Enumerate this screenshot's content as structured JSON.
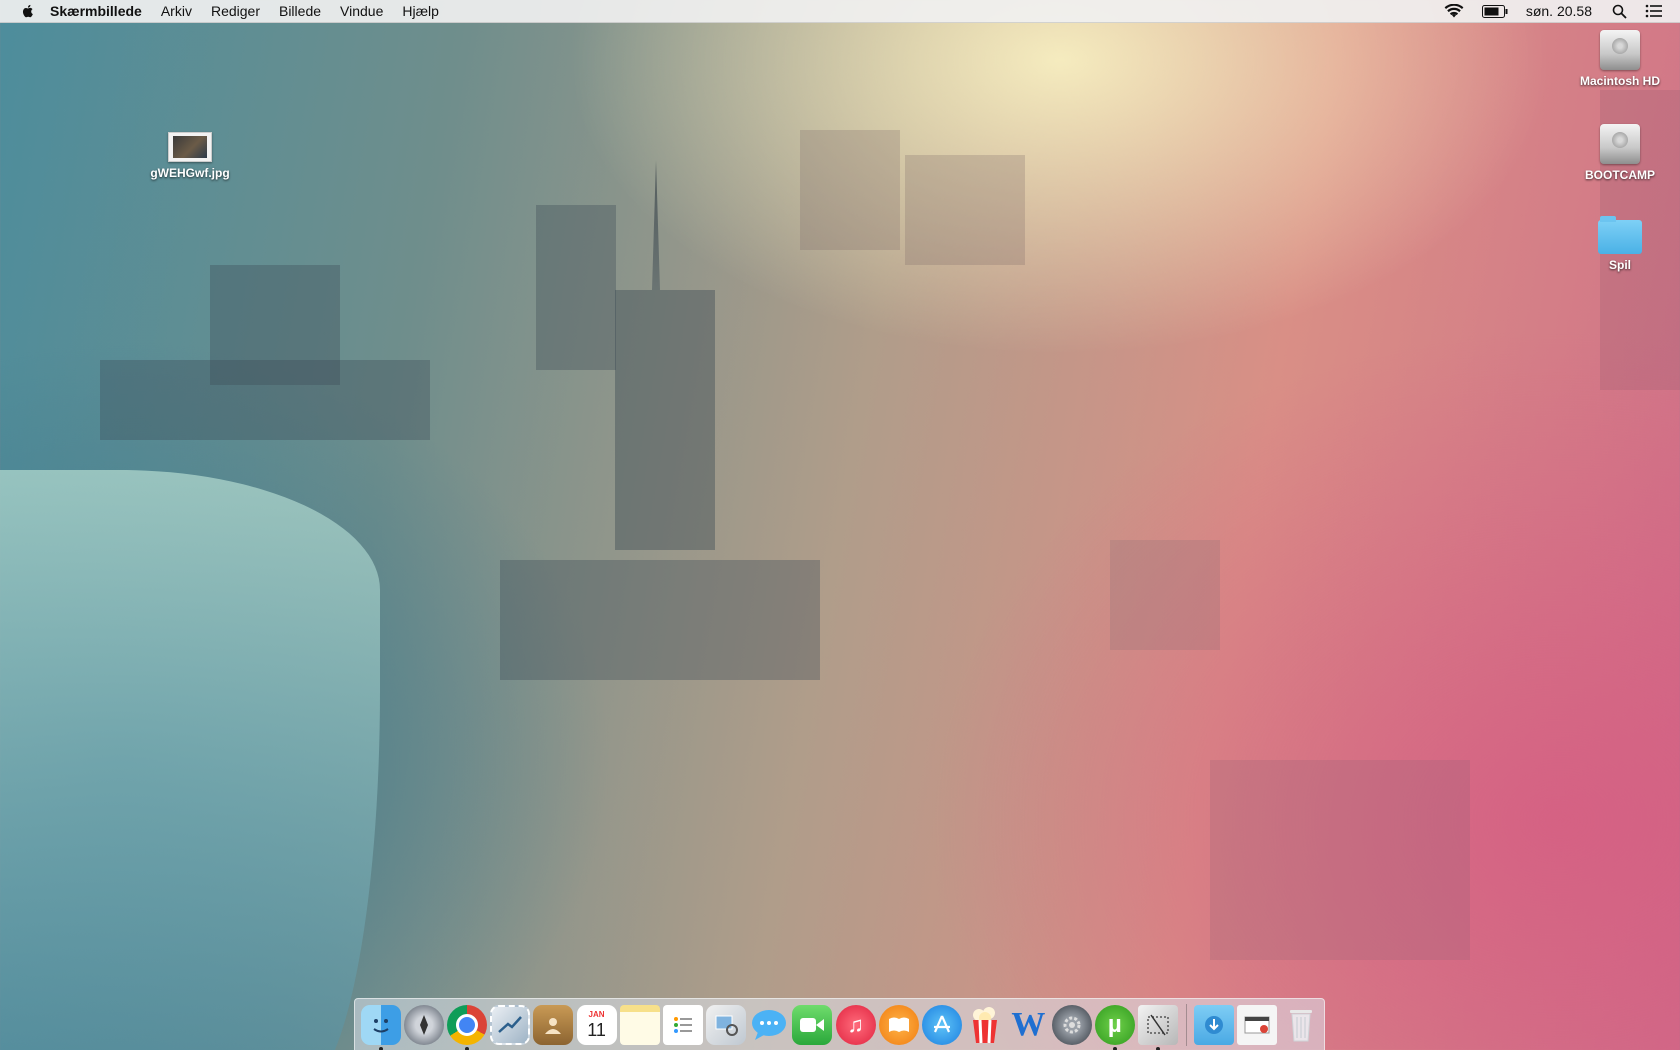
{
  "menubar": {
    "apple_icon": "apple-icon",
    "app_name": "Skærmbillede",
    "menus": [
      "Arkiv",
      "Rediger",
      "Billede",
      "Vindue",
      "Hjælp"
    ],
    "status_icons": [
      "wifi-icon",
      "battery-icon"
    ],
    "clock": "søn. 20.58",
    "right_icons": [
      "spotlight-icon",
      "notification-center-icon"
    ]
  },
  "desktop": {
    "file_icon_label": "gWEHGwf.jpg",
    "drives": [
      "Macintosh HD",
      "BOOTCAMP"
    ],
    "folder_label": "Spil"
  },
  "dock": {
    "calendar_month": "JAN",
    "calendar_day": "11",
    "apps": [
      {
        "icon": "finder-icon",
        "running": true
      },
      {
        "icon": "launchpad-icon",
        "running": false
      },
      {
        "icon": "chrome-icon",
        "running": true
      },
      {
        "icon": "mail-stamp-icon",
        "running": false
      },
      {
        "icon": "contacts-icon",
        "running": false
      },
      {
        "icon": "calendar-icon",
        "running": false
      },
      {
        "icon": "notes-icon",
        "running": false
      },
      {
        "icon": "reminders-icon",
        "running": false
      },
      {
        "icon": "preview-icon",
        "running": false
      },
      {
        "icon": "messages-icon",
        "running": false
      },
      {
        "icon": "facetime-icon",
        "running": false
      },
      {
        "icon": "itunes-icon",
        "running": false
      },
      {
        "icon": "ibooks-icon",
        "running": false
      },
      {
        "icon": "app-store-icon",
        "running": false
      },
      {
        "icon": "popcorn-time-icon",
        "running": false
      },
      {
        "icon": "word-icon",
        "running": false
      },
      {
        "icon": "system-preferences-icon",
        "running": false
      },
      {
        "icon": "utorrent-icon",
        "running": true
      },
      {
        "icon": "screenshot-utility-icon",
        "running": true
      }
    ],
    "stacks": [
      {
        "icon": "downloads-stack-icon"
      },
      {
        "icon": "recent-documents-stack-icon"
      },
      {
        "icon": "trash-icon"
      }
    ]
  },
  "colors": {
    "menubar_bg": "#f0f0f0",
    "folder_blue": "#4ab1e6"
  }
}
